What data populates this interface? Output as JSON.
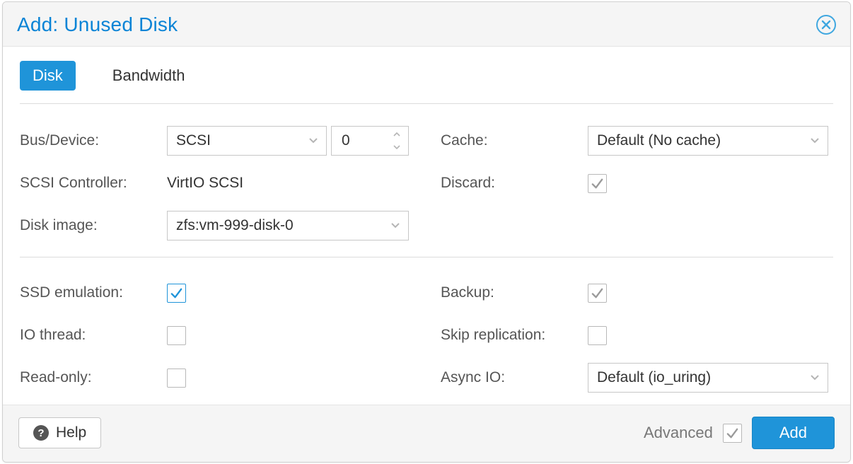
{
  "title": "Add: Unused Disk",
  "tabs": {
    "disk": "Disk",
    "bandwidth": "Bandwidth"
  },
  "labels": {
    "bus_device": "Bus/Device:",
    "scsi_controller": "SCSI Controller:",
    "disk_image": "Disk image:",
    "cache": "Cache:",
    "discard": "Discard:",
    "ssd_emulation": "SSD emulation:",
    "io_thread": "IO thread:",
    "read_only": "Read-only:",
    "backup": "Backup:",
    "skip_replication": "Skip replication:",
    "async_io": "Async IO:"
  },
  "values": {
    "bus": "SCSI",
    "device_number": "0",
    "scsi_controller": "VirtIO SCSI",
    "disk_image": "zfs:vm-999-disk-0",
    "cache": "Default (No cache)",
    "discard": true,
    "ssd_emulation": true,
    "io_thread": false,
    "read_only": false,
    "backup": true,
    "skip_replication": false,
    "async_io": "Default (io_uring)"
  },
  "footer": {
    "help": "Help",
    "advanced": "Advanced",
    "advanced_checked": true,
    "add": "Add"
  }
}
